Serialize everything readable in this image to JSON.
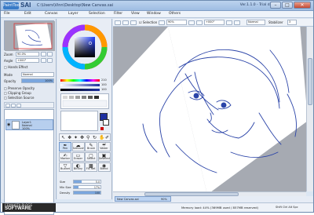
{
  "window": {
    "logo_text": "PaintTool",
    "app_name": "SAI",
    "title": "C:\\Users\\Vinn\\Desktop\\New Canvas.sai",
    "version": "Ver.1.1.0 - Trial day"
  },
  "menu": [
    "File",
    "Edit",
    "Canvas",
    "Layer",
    "Selection",
    "Filter",
    "View",
    "Window",
    "Others"
  ],
  "navigator": {
    "zoom_label": "Zoom",
    "zoom_value": "90.0%",
    "angle_label": "Angle",
    "angle_value": "+000°",
    "hands_effect": "Hands Effect"
  },
  "layer_panel": {
    "mode_label": "Mode",
    "mode_value": "Normal",
    "opacity_label": "Opacity",
    "opacity_value": "100%",
    "checks": [
      "Preserve Opacity",
      "Clipping Group",
      "Selection Source"
    ],
    "layer_name": "Layer1",
    "layer_mode": "Normal",
    "layer_opacity": "100%"
  },
  "color_panel": {
    "slider_values": [
      "210",
      "100",
      "100"
    ],
    "scratch_label": "Sc. Pad"
  },
  "tools": {
    "tiles": [
      {
        "label": "Pen",
        "glyph": "✒",
        "selected": true
      },
      {
        "label": "AirBrush",
        "glyph": "☁",
        "selected": false
      },
      {
        "label": "Brush",
        "glyph": "✎",
        "selected": false
      },
      {
        "label": "Water",
        "glyph": "☔",
        "selected": false
      },
      {
        "label": "Marker",
        "glyph": "✍",
        "selected": false
      },
      {
        "label": "Eraser",
        "glyph": "▭",
        "selected": false
      },
      {
        "label": "Select",
        "glyph": "▢",
        "selected": false
      },
      {
        "label": "Deselect",
        "glyph": "▣",
        "selected": false
      },
      {
        "label": "Bucket",
        "glyph": "▽",
        "selected": false
      },
      {
        "label": "Binary",
        "glyph": "◐",
        "selected": false
      },
      {
        "label": "Fill Ref.",
        "glyph": "▩",
        "selected": false
      },
      {
        "label": "Blend",
        "glyph": "◉",
        "selected": false
      }
    ],
    "mode_value": "Normal",
    "size_label": "Size",
    "size_value": "5.0",
    "min_size_label": "Min Size",
    "min_size_value": "17%",
    "density_label": "Density",
    "density_value": "100"
  },
  "toolbar": {
    "selection_label": "Selection",
    "zoom_value": "90%",
    "angle_value": "+000°",
    "mode_value": "Normal",
    "stabilizer_label": "Stabilizer",
    "stabilizer_value": "3"
  },
  "canvas_tab": {
    "name": "New Canvas.sai",
    "zoom": "90%"
  },
  "status": {
    "memory": "Memory load: 44% (369MB used / 857MB reserved)",
    "brand_line1": "CEMAKITA BLOGS",
    "brand_line2": "SOFTWARE",
    "right_label": "Shift Ctrl Alt Spc"
  },
  "colors": {
    "accent": "#3a7cc8",
    "sketch": "#2b44a8",
    "main_color": "#1c2fa0"
  }
}
